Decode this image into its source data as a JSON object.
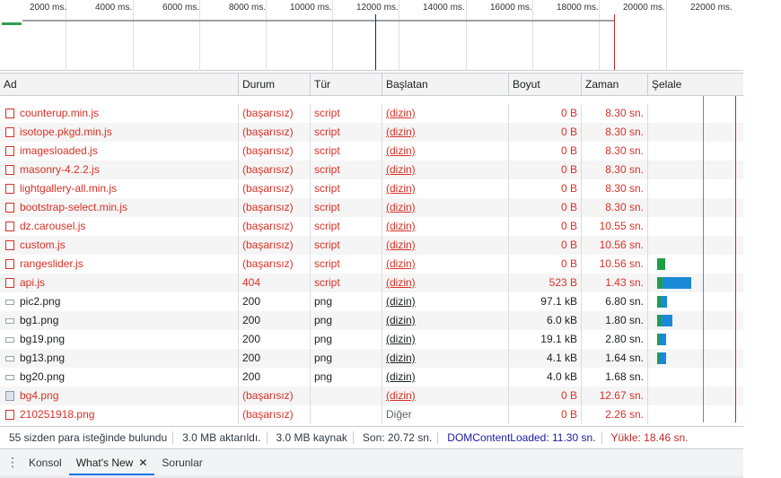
{
  "overview": {
    "ticks": [
      "2000 ms.",
      "4000 ms.",
      "6000 ms.",
      "8000 ms.",
      "10000 ms.",
      "12000 ms.",
      "14000 ms.",
      "16000 ms.",
      "18000 ms.",
      "20000 ms.",
      "22000 ms."
    ]
  },
  "columns": [
    "Ad",
    "Durum",
    "Tür",
    "Başlatan",
    "Boyut",
    "Zaman",
    "Şelale"
  ],
  "rows": [
    {
      "name": "counterup.min.js",
      "status": "(başarısız)",
      "type": "script",
      "initiator": "(dizin)",
      "size": "0 B",
      "time": "8.30 sn.",
      "icon": "script-file-icon",
      "error": true
    },
    {
      "name": "isotope.pkgd.min.js",
      "status": "(başarısız)",
      "type": "script",
      "initiator": "(dizin)",
      "size": "0 B",
      "time": "8.30 sn.",
      "icon": "script-file-icon",
      "error": true
    },
    {
      "name": "imagesloaded.js",
      "status": "(başarısız)",
      "type": "script",
      "initiator": "(dizin)",
      "size": "0 B",
      "time": "8.30 sn.",
      "icon": "script-file-icon",
      "error": true
    },
    {
      "name": "masonry-4.2.2.js",
      "status": "(başarısız)",
      "type": "script",
      "initiator": "(dizin)",
      "size": "0 B",
      "time": "8.30 sn.",
      "icon": "script-file-icon",
      "error": true
    },
    {
      "name": "lightgallery-all.min.js",
      "status": "(başarısız)",
      "type": "script",
      "initiator": "(dizin)",
      "size": "0 B",
      "time": "8.30 sn.",
      "icon": "script-file-icon",
      "error": true
    },
    {
      "name": "bootstrap-select.min.js",
      "status": "(başarısız)",
      "type": "script",
      "initiator": "(dizin)",
      "size": "0 B",
      "time": "8.30 sn.",
      "icon": "script-file-icon",
      "error": true
    },
    {
      "name": "dz.carousel.js",
      "status": "(başarısız)",
      "type": "script",
      "initiator": "(dizin)",
      "size": "0 B",
      "time": "10.55 sn.",
      "icon": "script-file-icon",
      "error": true
    },
    {
      "name": "custom.js",
      "status": "(başarısız)",
      "type": "script",
      "initiator": "(dizin)",
      "size": "0 B",
      "time": "10.56 sn.",
      "icon": "script-file-icon",
      "error": true
    },
    {
      "name": "rangeslider.js",
      "status": "(başarısız)",
      "type": "script",
      "initiator": "(dizin)",
      "size": "0 B",
      "time": "10.56 sn.",
      "icon": "script-file-icon",
      "error": true
    },
    {
      "name": "api.js",
      "status": "404",
      "type": "script",
      "initiator": "(dizin)",
      "size": "523 B",
      "time": "1.43 sn.",
      "icon": "script-file-icon",
      "error": true
    },
    {
      "name": "pic2.png",
      "status": "200",
      "type": "png",
      "initiator": "(dizin)",
      "size": "97.1 kB",
      "time": "6.80 sn.",
      "icon": "image-file-icon",
      "error": false
    },
    {
      "name": "bg1.png",
      "status": "200",
      "type": "png",
      "initiator": "(dizin)",
      "size": "6.0 kB",
      "time": "1.80 sn.",
      "icon": "image-file-icon",
      "error": false
    },
    {
      "name": "bg19.png",
      "status": "200",
      "type": "png",
      "initiator": "(dizin)",
      "size": "19.1 kB",
      "time": "2.80 sn.",
      "icon": "image-file-icon",
      "error": false
    },
    {
      "name": "bg13.png",
      "status": "200",
      "type": "png",
      "initiator": "(dizin)",
      "size": "4.1 kB",
      "time": "1.64 sn.",
      "icon": "image-file-icon",
      "error": false
    },
    {
      "name": "bg20.png",
      "status": "200",
      "type": "png",
      "initiator": "(dizin)",
      "size": "4.0 kB",
      "time": "1.68 sn.",
      "icon": "image-file-icon",
      "error": false
    },
    {
      "name": "bg4.png",
      "status": "(başarısız)",
      "type": "",
      "initiator": "(dizin)",
      "size": "0 B",
      "time": "12.67 sn.",
      "icon": "image-preview-icon",
      "error": true
    },
    {
      "name": "210251918.png",
      "status": "(başarısız)",
      "type": "",
      "initiator": "Diğer",
      "size": "0 B",
      "time": "2.26 sn.",
      "icon": "document-file-icon",
      "error": true
    }
  ],
  "summary": {
    "requests": "55 sizden para isteğinde bulundu",
    "transferred": "3.0 MB aktarıldı.",
    "resources": "3.0 MB kaynak",
    "finish": "Son: 20.72 sn.",
    "dom_content_loaded": "DOMContentLoaded: 11.30 sn.",
    "load": "Yükle: 18.46 sn."
  },
  "drawer": {
    "tabs": [
      "Konsol",
      "What's New",
      "Sorunlar"
    ],
    "active_tab": "What's New"
  },
  "colors": {
    "error": "#d93025",
    "dom_line": "#1a1aa6",
    "load_line": "#c62828",
    "waterfall_green": "#1e9e4b",
    "waterfall_blue": "#1a8ad6"
  }
}
